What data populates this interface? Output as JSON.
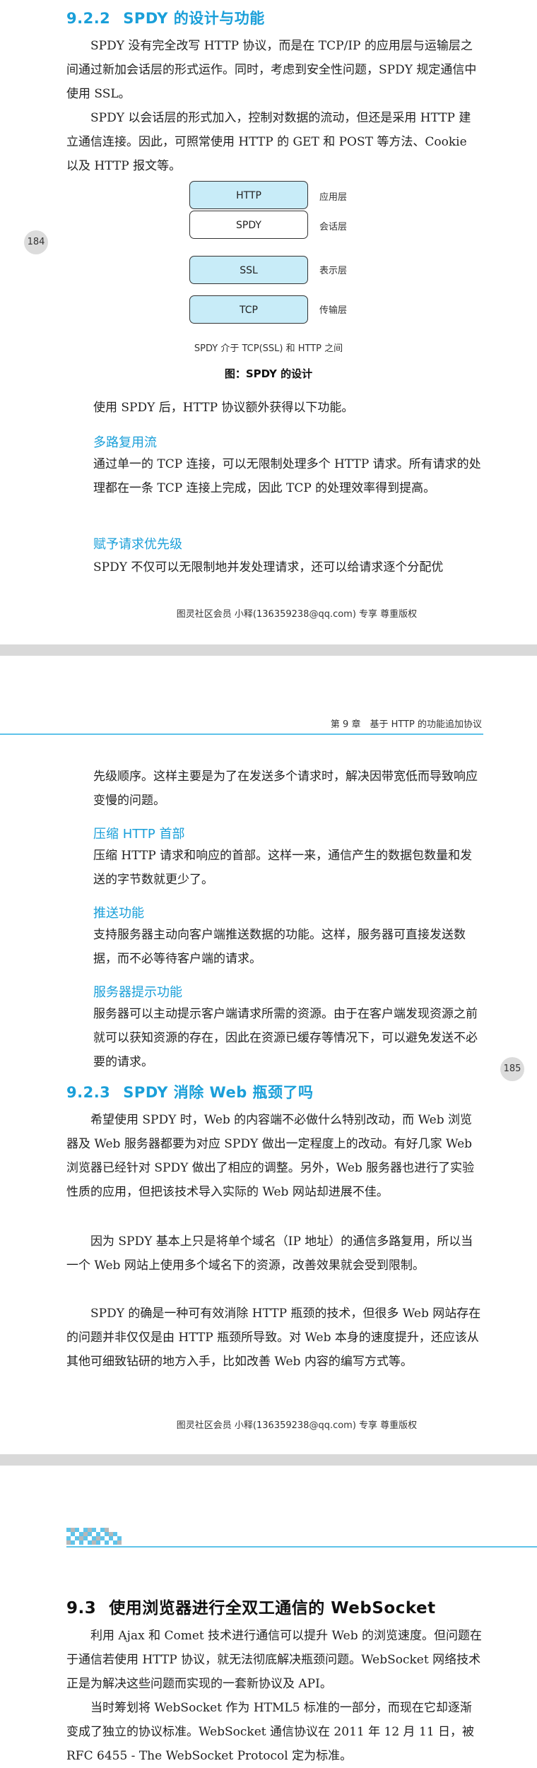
{
  "page1": {
    "section_number": "9.2.2",
    "section_title": "SPDY 的设计与功能",
    "para1": "SPDY 没有完全改写 HTTP 协议，而是在 TCP/IP 的应用层与运输层之间通过新加会话层的形式运作。同时，考虑到安全性问题，SPDY 规定通信中使用 SSL。",
    "para2": "SPDY 以会话层的形式加入，控制对数据的流动，但还是采用 HTTP 建立通信连接。因此，可照常使用 HTTP 的 GET 和 POST 等方法、Cookie 以及 HTTP 报文等。",
    "diagram": {
      "layers": [
        {
          "name": "HTTP",
          "label": "应用层"
        },
        {
          "name": "SPDY",
          "label": "会话层"
        },
        {
          "name": "SSL",
          "label": "表示层"
        },
        {
          "name": "TCP",
          "label": "传输层"
        }
      ],
      "note": "SPDY 介于 TCP(SSL) 和 HTTP 之间",
      "caption": "图：SPDY 的设计"
    },
    "page_number": "184",
    "intro": "使用 SPDY 后，HTTP 协议额外获得以下功能。",
    "feature1_title": "多路复用流",
    "feature1_body": "通过单一的 TCP 连接，可以无限制处理多个 HTTP 请求。所有请求的处理都在一条 TCP 连接上完成，因此 TCP 的处理效率得到提高。",
    "feature2_title": "赋予请求优先级",
    "feature2_body": "SPDY 不仅可以无限制地并发处理请求，还可以给请求逐个分配优",
    "footer": "图灵社区会员 小释(136359238@qq.com) 专享 尊重版权"
  },
  "page2": {
    "chapter_header": "第 9 章　基于 HTTP 的功能追加协议",
    "cont": "先级顺序。这样主要是为了在发送多个请求时，解决因带宽低而导致响应变慢的问题。",
    "feature3_title": "压缩 HTTP 首部",
    "feature3_body": "压缩 HTTP 请求和响应的首部。这样一来，通信产生的数据包数量和发送的字节数就更少了。",
    "feature4_title": "推送功能",
    "feature4_body": "支持服务器主动向客户端推送数据的功能。这样，服务器可直接发送数据，而不必等待客户端的请求。",
    "feature5_title": "服务器提示功能",
    "feature5_body": "服务器可以主动提示客户端请求所需的资源。由于在客户端发现资源之前就可以获知资源的存在，因此在资源已缓存等情况下，可以避免发送不必要的请求。",
    "page_number": "185",
    "section_number": "9.2.3",
    "section_title": "SPDY 消除 Web 瓶颈了吗",
    "para1": "希望使用 SPDY 时，Web 的内容端不必做什么特别改动，而 Web 浏览器及 Web 服务器都要为对应 SPDY 做出一定程度上的改动。有好几家 Web 浏览器已经针对 SPDY 做出了相应的调整。另外，Web 服务器也进行了实验性质的应用，但把该技术导入实际的 Web 网站却进展不佳。",
    "para2": "因为 SPDY 基本上只是将单个域名（IP 地址）的通信多路复用，所以当一个 Web 网站上使用多个域名下的资源，改善效果就会受到限制。",
    "para3": "SPDY 的确是一种可有效消除 HTTP 瓶颈的技术，但很多 Web 网站存在的问题并非仅仅是由 HTTP 瓶颈所导致。对 Web 本身的速度提升，还应该从其他可细致钻研的地方入手，比如改善 Web 内容的编写方式等。",
    "footer": "图灵社区会员 小释(136359238@qq.com) 专享 尊重版权"
  },
  "page3": {
    "section_number": "9.3",
    "section_title": "使用浏览器进行全双工通信的 WebSocket",
    "para1": "利用 Ajax 和 Comet 技术进行通信可以提升 Web 的浏览速度。但问题在于通信若使用 HTTP 协议，就无法彻底解决瓶颈问题。WebSocket 网络技术正是为解决这些问题而实现的一套新协议及 API。",
    "para2": "当时筹划将 WebSocket 作为 HTML5 标准的一部分，而现在它却逐渐变成了独立的协议标准。WebSocket 通信协议在 2011 年 12 月 11 日，被 RFC 6455 - The WebSocket Protocol 定为标准。"
  },
  "colors": {
    "accent": "#1a9fd9",
    "layer_fill": "#c8ecf8",
    "rule": "#5fc3ea",
    "page_gap": "#d9d9d9"
  }
}
